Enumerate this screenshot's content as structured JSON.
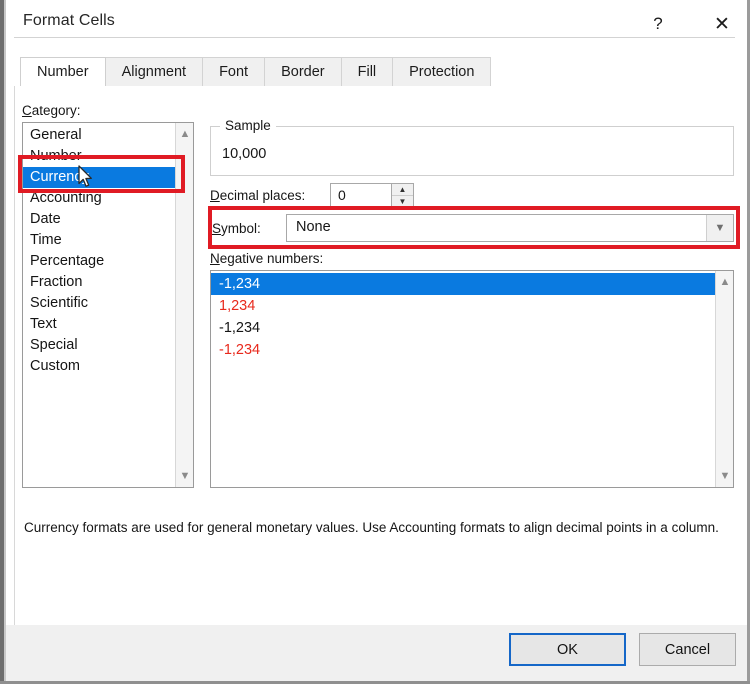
{
  "window": {
    "title": "Format Cells",
    "help_icon": "question-mark-icon",
    "close_icon": "close-icon"
  },
  "tabs": [
    {
      "label": "Number",
      "active": true
    },
    {
      "label": "Alignment",
      "active": false
    },
    {
      "label": "Font",
      "active": false
    },
    {
      "label": "Border",
      "active": false
    },
    {
      "label": "Fill",
      "active": false
    },
    {
      "label": "Protection",
      "active": false
    }
  ],
  "category": {
    "label": "Category:",
    "label_accel": "C",
    "label_rest": "ategory:",
    "items": [
      "General",
      "Number",
      "Currency",
      "Accounting",
      "Date",
      "Time",
      "Percentage",
      "Fraction",
      "Scientific",
      "Text",
      "Special",
      "Custom"
    ],
    "selected": "Currency",
    "scroll_up_icon": "chevron-up-icon",
    "scroll_down_icon": "chevron-down-icon"
  },
  "sample": {
    "legend": "Sample",
    "value": "10,000"
  },
  "decimal_places": {
    "label_accel": "D",
    "label_rest": "ecimal places:",
    "value": "0",
    "spinner_up_icon": "spinner-up-icon",
    "spinner_down_icon": "spinner-down-icon"
  },
  "symbol": {
    "label_accel": "S",
    "label_rest": "ymbol:",
    "value": "None",
    "dropdown_icon": "chevron-down-icon"
  },
  "negative_numbers": {
    "label_accel": "N",
    "label_rest": "egative numbers:",
    "items": [
      {
        "text": "-1,234",
        "color": "#ffffff",
        "selected": true
      },
      {
        "text": "1,234",
        "color": "#e8291c",
        "selected": false
      },
      {
        "text": "-1,234",
        "color": "#161616",
        "selected": false
      },
      {
        "text": "-1,234",
        "color": "#e8291c",
        "selected": false
      }
    ],
    "scroll_up_icon": "chevron-up-icon",
    "scroll_down_icon": "chevron-down-icon"
  },
  "description": "Currency formats are used for general monetary values.  Use Accounting formats to align decimal points in a column.",
  "footer": {
    "ok_label": "OK",
    "cancel_label": "Cancel"
  },
  "annotations": {
    "highlight_color": "#e01b24",
    "boxes": [
      "category-currency-row",
      "symbol-dropdown-row"
    ]
  },
  "cursor": {
    "icon": "mouse-pointer-icon"
  },
  "colors": {
    "selection_blue": "#0a7ae0",
    "focus_blue": "#1567c8",
    "negative_red": "#e8291c",
    "annotation_red": "#e01b24"
  }
}
